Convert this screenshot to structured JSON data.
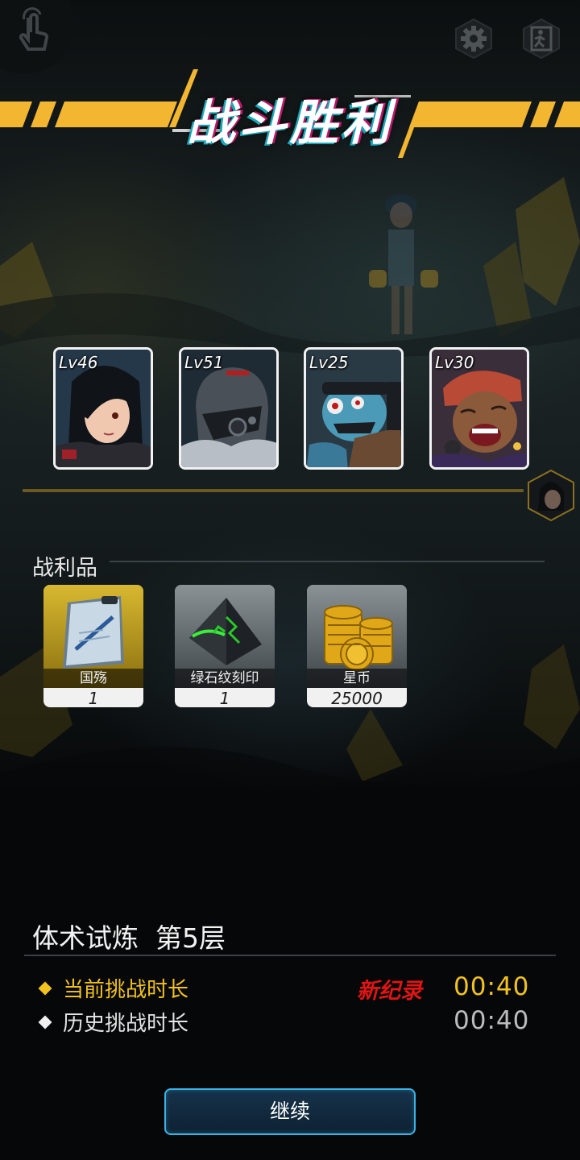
{
  "header": {
    "title": "战斗胜利"
  },
  "heroes": [
    {
      "level": "Lv46"
    },
    {
      "level": "Lv51"
    },
    {
      "level": "Lv25"
    },
    {
      "level": "Lv30"
    }
  ],
  "loot": {
    "title": "战利品",
    "items": [
      {
        "name": "国殇",
        "qty": "1"
      },
      {
        "name": "绿石纹刻印",
        "qty": "1"
      },
      {
        "name": "星币",
        "qty": "25000"
      }
    ]
  },
  "stage": {
    "name": "体术试炼  第5层",
    "current_label": "当前挑战时长",
    "history_label": "历史挑战时长",
    "new_record": "新纪录",
    "current_time": "00:40",
    "history_time": "00:40"
  },
  "buttons": {
    "continue": "继续"
  },
  "colors": {
    "accent": "#f2b630",
    "record": "#e01414",
    "time": "#f2c21e",
    "button_border": "#3ab4e6"
  }
}
